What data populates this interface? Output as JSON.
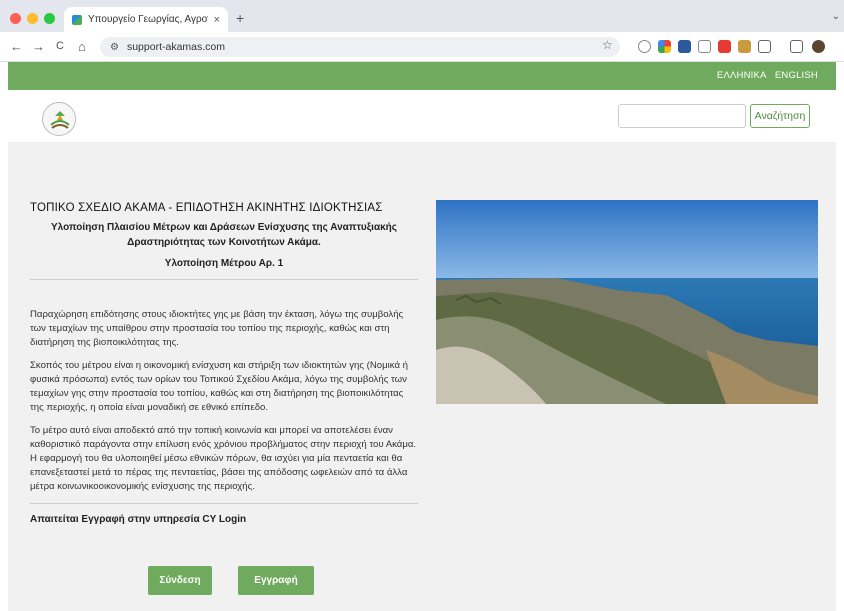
{
  "browser": {
    "tab_title": "Υπουργείο Γεωργίας, Αγροτι",
    "tab_close": "×",
    "new_tab": "+",
    "url": "support-akamas.com",
    "back": "←",
    "forward": "→",
    "reload": "C",
    "home": "⌂",
    "star": "☆"
  },
  "site": {
    "lang_el": "ΕΛΛΗΝΙΚΑ",
    "lang_en": "ENGLISH",
    "search_button": "Αναζήτηση",
    "search_value": ""
  },
  "article": {
    "title": "ΤΟΠΙΚΟ ΣΧΕΔΙΟ ΑΚΑΜΑ - ΕΠΙΔΟΤΗΣΗ ΑΚΙΝΗΤΗΣ ΙΔΙΟΚΤΗΣΙΑΣ",
    "subtitle": "Υλοποίηση Πλαισίου Μέτρων και Δράσεων Ενίσχυσης της Αναπτυξιακής Δραστηριότητας των Κοινοτήτων Ακάμα.",
    "measure": "Υλοποίηση Μέτρου Αρ. 1",
    "paragraphs": [
      "Παραχώρηση επιδότησης στους ιδιοκτήτες γης με βάση την έκταση, λόγω της συμβολής των τεμαχίων της υπαίθρου στην προστασία του τοπίου της περιοχής, καθώς και στη διατήρηση της βιοποικιλότητας της.",
      "Σκοπός του μέτρου είναι η οικονομική ενίσχυση και στήριξη των ιδιοκτητών γης (Νομικά ή φυσικά πρόσωπα) εντός των ορίων του Τοπικού Σχεδίου Ακάμα, λόγω της συμβολής των τεμαχίων γης στην προστασία του τοπίου, καθώς και στη διατήρηση της βιοποικιλότητας της περιοχής, η οποία είναι μοναδική σε εθνικό επίπεδο.",
      "Το μέτρο αυτό είναι αποδεκτό από την τοπική κοινωνία και μπορεί να αποτελέσει έναν καθοριστικό παράγοντα στην επίλυση ενός χρόνιου προβλήματος στην περιοχή του Ακάμα. Η εφαρμογή του θα υλοποιηθεί μέσω εθνικών πόρων, θα ισχύει για μία πενταετία και θα επανεξεταστεί μετά το πέρας της πενταετίας, βάσει της απόδοσης ωφελειών από τα άλλα μέτρα κοινωνικοοικονομικής ενίσχυσης της περιοχής."
    ],
    "requirement": "Απαιτείται Εγγραφή στην υπηρεσία CY Login"
  },
  "buttons": {
    "login": "Σύνδεση",
    "register": "Εγγραφή"
  },
  "colors": {
    "brand_green": "#70aa5e"
  }
}
